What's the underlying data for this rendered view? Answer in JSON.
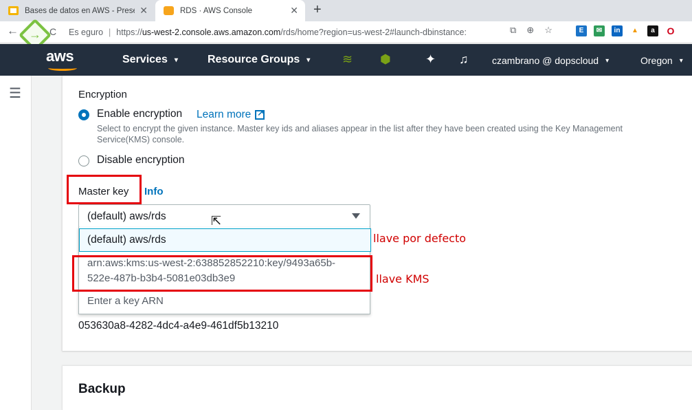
{
  "browser": {
    "tabs": [
      {
        "title": "Bases de datos en AWS - Present",
        "active": false,
        "favicon": "slides-icon"
      },
      {
        "title": "RDS · AWS Console",
        "active": true,
        "favicon": "aws-icon"
      }
    ],
    "new_tab": "+",
    "close_glyph": "✕",
    "omnibox": {
      "security_text": "Es  eguro",
      "separator": "|",
      "url_prefix": "https://",
      "url_host": "us-west-2.console.aws.amazon.com",
      "url_path": "/rds/home?region=us-west-2#launch-dbinstance:"
    },
    "extensions": [
      {
        "name": "ext-blue-icon",
        "label": "E",
        "color": "#1a73c8"
      },
      {
        "name": "ext-green-icon",
        "label": "✉",
        "color": "#2e9c5a"
      },
      {
        "name": "linkedin-icon",
        "label": "in",
        "color": "#0a66c2"
      },
      {
        "name": "ext-triangle-icon",
        "label": "▲",
        "color": "#f29900"
      },
      {
        "name": "amazon-assistant-icon",
        "label": "a",
        "color": "#111111"
      },
      {
        "name": "opera-icon",
        "label": "O",
        "color": "#d0021b"
      }
    ]
  },
  "aws_nav": {
    "logo": "aws",
    "services": "Services",
    "resource_groups": "Resource Groups",
    "user": "czambrano @ dopscloud",
    "region": "Oregon",
    "caret": "▾"
  },
  "encryption": {
    "heading": "Encryption",
    "enable_label": "Enable encryption",
    "learn_more": "Learn more",
    "description": "Select to encrypt the given instance. Master key ids and aliases appear in the list after they have been created using the Key Management Service(KMS) console.",
    "disable_label": "Disable encryption",
    "enabled": true
  },
  "master_key": {
    "label": "Master key",
    "info": "Info",
    "selected": "(default) aws/rds",
    "options": [
      "(default) aws/rds",
      "arn:aws:kms:us-west-2:638852852210:key/9493a65b-522e-487b-b3b4-5081e03db3e9",
      "Enter a key ARN"
    ],
    "option_arn_line1": "arn:aws:kms:us-west-2:638852852210:key/9493a65b-",
    "option_arn_line2": "522e-487b-b3b4-5081e03db3e9",
    "key_id": "053630a8-4282-4dc4-a4e9-461df5b13210"
  },
  "annotations": {
    "default_key": "llave por defecto",
    "kms_key": "llave KMS",
    "color": "#d00000"
  },
  "backup": {
    "heading": "Backup"
  }
}
